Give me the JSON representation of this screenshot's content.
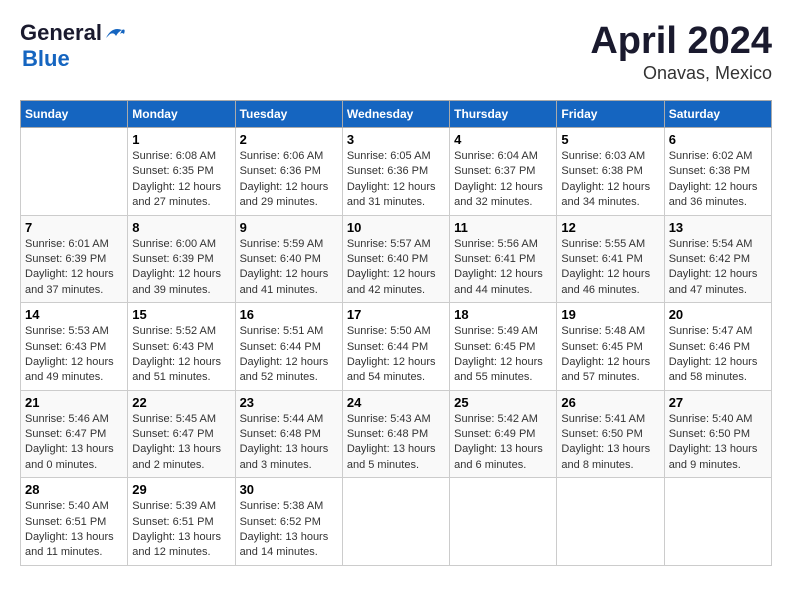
{
  "header": {
    "logo_general": "General",
    "logo_blue": "Blue",
    "month_year": "April 2024",
    "location": "Onavas, Mexico"
  },
  "weekdays": [
    "Sunday",
    "Monday",
    "Tuesday",
    "Wednesday",
    "Thursday",
    "Friday",
    "Saturday"
  ],
  "weeks": [
    [
      {
        "day": "",
        "info": ""
      },
      {
        "day": "1",
        "info": "Sunrise: 6:08 AM\nSunset: 6:35 PM\nDaylight: 12 hours\nand 27 minutes."
      },
      {
        "day": "2",
        "info": "Sunrise: 6:06 AM\nSunset: 6:36 PM\nDaylight: 12 hours\nand 29 minutes."
      },
      {
        "day": "3",
        "info": "Sunrise: 6:05 AM\nSunset: 6:36 PM\nDaylight: 12 hours\nand 31 minutes."
      },
      {
        "day": "4",
        "info": "Sunrise: 6:04 AM\nSunset: 6:37 PM\nDaylight: 12 hours\nand 32 minutes."
      },
      {
        "day": "5",
        "info": "Sunrise: 6:03 AM\nSunset: 6:38 PM\nDaylight: 12 hours\nand 34 minutes."
      },
      {
        "day": "6",
        "info": "Sunrise: 6:02 AM\nSunset: 6:38 PM\nDaylight: 12 hours\nand 36 minutes."
      }
    ],
    [
      {
        "day": "7",
        "info": "Sunrise: 6:01 AM\nSunset: 6:39 PM\nDaylight: 12 hours\nand 37 minutes."
      },
      {
        "day": "8",
        "info": "Sunrise: 6:00 AM\nSunset: 6:39 PM\nDaylight: 12 hours\nand 39 minutes."
      },
      {
        "day": "9",
        "info": "Sunrise: 5:59 AM\nSunset: 6:40 PM\nDaylight: 12 hours\nand 41 minutes."
      },
      {
        "day": "10",
        "info": "Sunrise: 5:57 AM\nSunset: 6:40 PM\nDaylight: 12 hours\nand 42 minutes."
      },
      {
        "day": "11",
        "info": "Sunrise: 5:56 AM\nSunset: 6:41 PM\nDaylight: 12 hours\nand 44 minutes."
      },
      {
        "day": "12",
        "info": "Sunrise: 5:55 AM\nSunset: 6:41 PM\nDaylight: 12 hours\nand 46 minutes."
      },
      {
        "day": "13",
        "info": "Sunrise: 5:54 AM\nSunset: 6:42 PM\nDaylight: 12 hours\nand 47 minutes."
      }
    ],
    [
      {
        "day": "14",
        "info": "Sunrise: 5:53 AM\nSunset: 6:43 PM\nDaylight: 12 hours\nand 49 minutes."
      },
      {
        "day": "15",
        "info": "Sunrise: 5:52 AM\nSunset: 6:43 PM\nDaylight: 12 hours\nand 51 minutes."
      },
      {
        "day": "16",
        "info": "Sunrise: 5:51 AM\nSunset: 6:44 PM\nDaylight: 12 hours\nand 52 minutes."
      },
      {
        "day": "17",
        "info": "Sunrise: 5:50 AM\nSunset: 6:44 PM\nDaylight: 12 hours\nand 54 minutes."
      },
      {
        "day": "18",
        "info": "Sunrise: 5:49 AM\nSunset: 6:45 PM\nDaylight: 12 hours\nand 55 minutes."
      },
      {
        "day": "19",
        "info": "Sunrise: 5:48 AM\nSunset: 6:45 PM\nDaylight: 12 hours\nand 57 minutes."
      },
      {
        "day": "20",
        "info": "Sunrise: 5:47 AM\nSunset: 6:46 PM\nDaylight: 12 hours\nand 58 minutes."
      }
    ],
    [
      {
        "day": "21",
        "info": "Sunrise: 5:46 AM\nSunset: 6:47 PM\nDaylight: 13 hours\nand 0 minutes."
      },
      {
        "day": "22",
        "info": "Sunrise: 5:45 AM\nSunset: 6:47 PM\nDaylight: 13 hours\nand 2 minutes."
      },
      {
        "day": "23",
        "info": "Sunrise: 5:44 AM\nSunset: 6:48 PM\nDaylight: 13 hours\nand 3 minutes."
      },
      {
        "day": "24",
        "info": "Sunrise: 5:43 AM\nSunset: 6:48 PM\nDaylight: 13 hours\nand 5 minutes."
      },
      {
        "day": "25",
        "info": "Sunrise: 5:42 AM\nSunset: 6:49 PM\nDaylight: 13 hours\nand 6 minutes."
      },
      {
        "day": "26",
        "info": "Sunrise: 5:41 AM\nSunset: 6:50 PM\nDaylight: 13 hours\nand 8 minutes."
      },
      {
        "day": "27",
        "info": "Sunrise: 5:40 AM\nSunset: 6:50 PM\nDaylight: 13 hours\nand 9 minutes."
      }
    ],
    [
      {
        "day": "28",
        "info": "Sunrise: 5:40 AM\nSunset: 6:51 PM\nDaylight: 13 hours\nand 11 minutes."
      },
      {
        "day": "29",
        "info": "Sunrise: 5:39 AM\nSunset: 6:51 PM\nDaylight: 13 hours\nand 12 minutes."
      },
      {
        "day": "30",
        "info": "Sunrise: 5:38 AM\nSunset: 6:52 PM\nDaylight: 13 hours\nand 14 minutes."
      },
      {
        "day": "",
        "info": ""
      },
      {
        "day": "",
        "info": ""
      },
      {
        "day": "",
        "info": ""
      },
      {
        "day": "",
        "info": ""
      }
    ]
  ]
}
